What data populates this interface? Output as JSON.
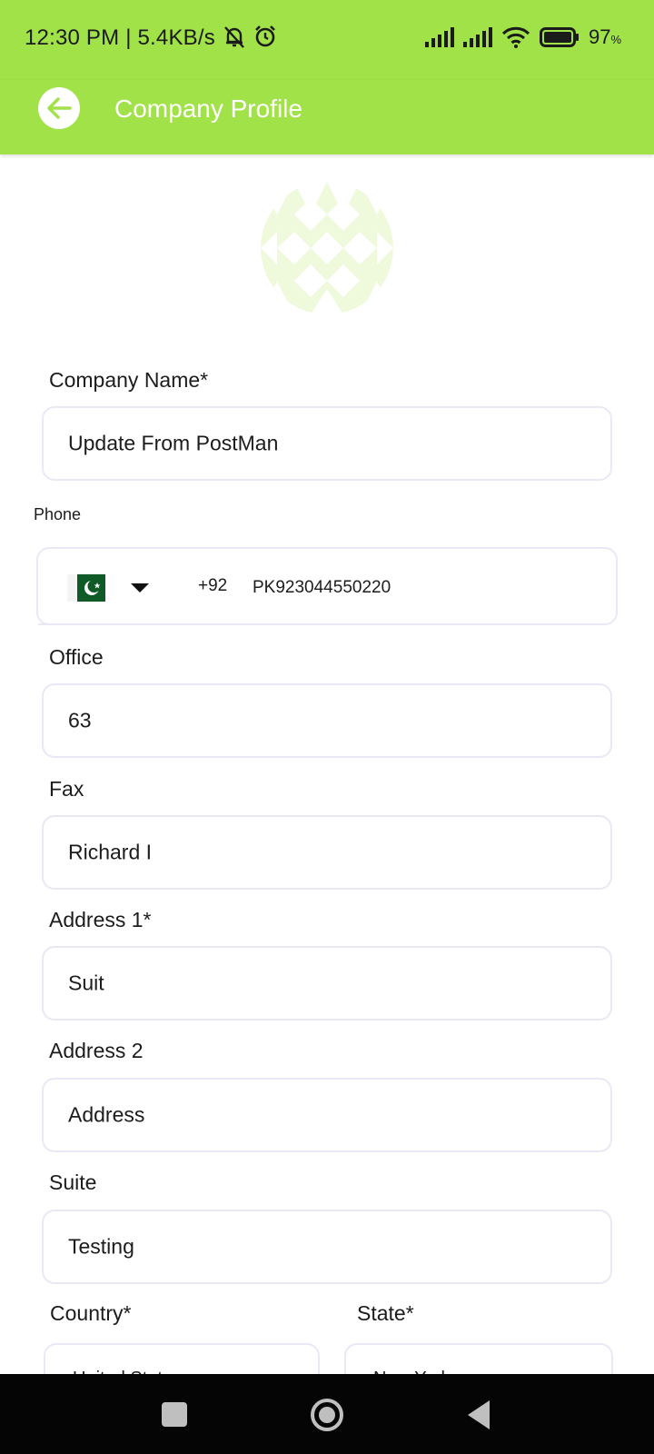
{
  "status_bar": {
    "time": "12:30 PM | 5.4KB/s",
    "battery_percent": "97",
    "battery_unit": "%",
    "icons": [
      "mute-bell-icon",
      "alarm-icon",
      "signal-icon",
      "signal-icon",
      "wifi-icon",
      "battery-icon"
    ]
  },
  "app_bar": {
    "title": "Company Profile",
    "back_icon": "arrow-left-icon",
    "background": "#a0e248"
  },
  "form": {
    "company_name": {
      "label": "Company Name*",
      "value": "Update From PostMan"
    },
    "phone": {
      "label": "Phone",
      "flag": "pakistan-flag-icon",
      "country_code": "+92",
      "value": "PK923044550220"
    },
    "office": {
      "label": "Office",
      "value": "63"
    },
    "fax": {
      "label": "Fax",
      "value": "Richard I"
    },
    "address1": {
      "label": "Address 1*",
      "value": "Suit"
    },
    "address2": {
      "label": "Address 2",
      "value": "Address"
    },
    "suite": {
      "label": "Suite",
      "value": "Testing"
    },
    "country": {
      "label": "Country*",
      "value": "United States"
    },
    "state": {
      "label": "State*",
      "value": "New York"
    }
  },
  "nav_bar": {
    "icons": [
      "recents-icon",
      "home-icon",
      "back-icon"
    ]
  }
}
